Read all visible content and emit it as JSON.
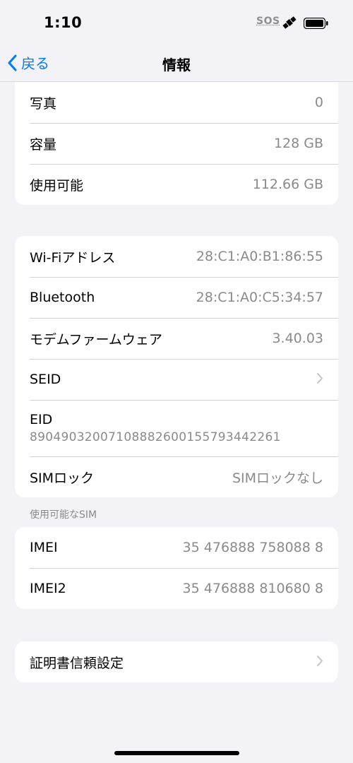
{
  "status": {
    "time": "1:10",
    "sos": "SOS"
  },
  "nav": {
    "back_label": "戻る",
    "title": "情報"
  },
  "storage_group": [
    {
      "label": "写真",
      "value": "0"
    },
    {
      "label": "容量",
      "value": "128 GB"
    },
    {
      "label": "使用可能",
      "value": "112.66 GB"
    }
  ],
  "network_group": {
    "wifi": {
      "label": "Wi-Fiアドレス",
      "value": "28:C1:A0:B1:86:55"
    },
    "bluetooth": {
      "label": "Bluetooth",
      "value": "28:C1:A0:C5:34:57"
    },
    "modem": {
      "label": "モデムファームウェア",
      "value": "3.40.03"
    },
    "seid": {
      "label": "SEID"
    },
    "eid": {
      "label": "EID",
      "value": "89049032007108882600155793442261"
    },
    "simlock": {
      "label": "SIMロック",
      "value": "SIMロックなし"
    }
  },
  "sim_section_header": "使用可能なSIM",
  "imei_group": [
    {
      "label": "IMEI",
      "value": "35 476888 758088 8"
    },
    {
      "label": "IMEI2",
      "value": "35 476888 810680 8"
    }
  ],
  "cert_group": {
    "label": "証明書信頼設定"
  },
  "icons": {
    "back": "chevron-left-icon",
    "chevron": "chevron-right-icon",
    "satellite": "satellite-icon",
    "battery": "battery-icon"
  },
  "colors": {
    "accent": "#007aff",
    "background": "#f2f2f7",
    "secondary_text": "#8a8a8e"
  }
}
